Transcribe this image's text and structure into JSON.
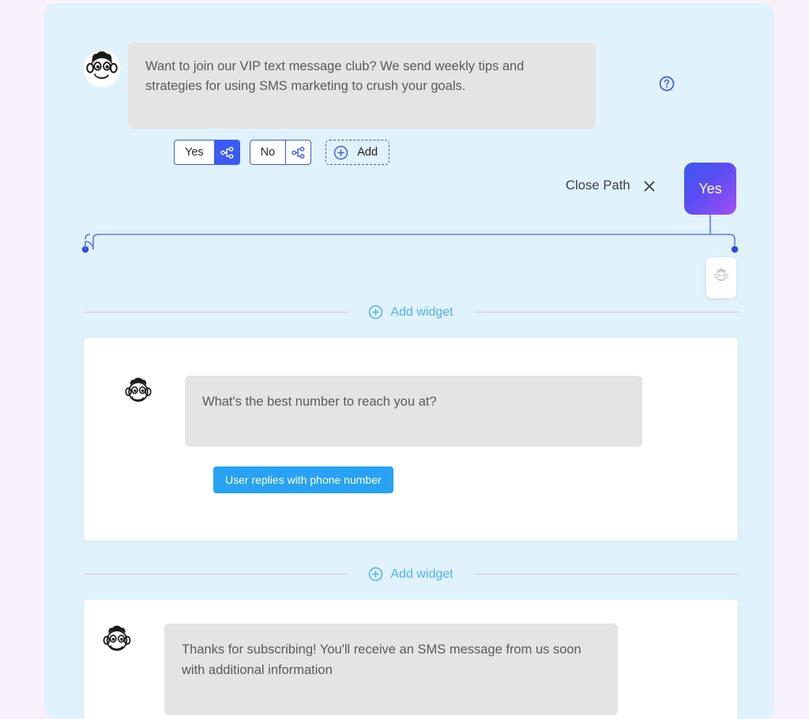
{
  "canvas": {
    "background_color": "#e0f2fc",
    "page_background_color": "#f8f0fa"
  },
  "top_message": {
    "avatar_icon": "freddie-monkey-avatar-icon",
    "bubble_text": "Want to join our VIP text message club? We send weekly tips and strategies for using SMS marketing to crush your goals.",
    "help_icon": "question-circle-icon"
  },
  "answers": {
    "chips": [
      {
        "label": "Yes",
        "icon": "branch-node-icon",
        "selected": true
      },
      {
        "label": "No",
        "icon": "branch-node-icon",
        "selected": false
      }
    ],
    "add": {
      "label": "Add",
      "icon": "plus-circle-icon"
    },
    "accent_color": "#3b5bf5"
  },
  "path": {
    "close_label": "Close Path",
    "close_icon": "close-x-icon",
    "node_label": "Yes",
    "node_gradient_from": "#3d58f0",
    "node_gradient_to": "#a44ff5",
    "connector_color": "#6078f0",
    "ghost_node_icon": "freddie-monkey-placeholder-icon"
  },
  "dividers": [
    {
      "label": "Add widget",
      "icon": "plus-circle-icon",
      "line_color": "#cfc2ee",
      "text_color": "#4db1fa"
    },
    {
      "label": "Add widget",
      "icon": "plus-circle-icon",
      "line_color": "#cfc2ee",
      "text_color": "#4db1fa"
    }
  ],
  "widgets": [
    {
      "avatar_icon": "freddie-monkey-avatar-icon",
      "bubble_text": "What's the best number to reach you at?",
      "reply_chip_label": "User replies with phone number",
      "reply_chip_color": "#27a2f5"
    },
    {
      "avatar_icon": "freddie-monkey-avatar-icon",
      "bubble_text": "Thanks for subscribing! You'll receive an SMS message from us soon with additional information"
    }
  ]
}
